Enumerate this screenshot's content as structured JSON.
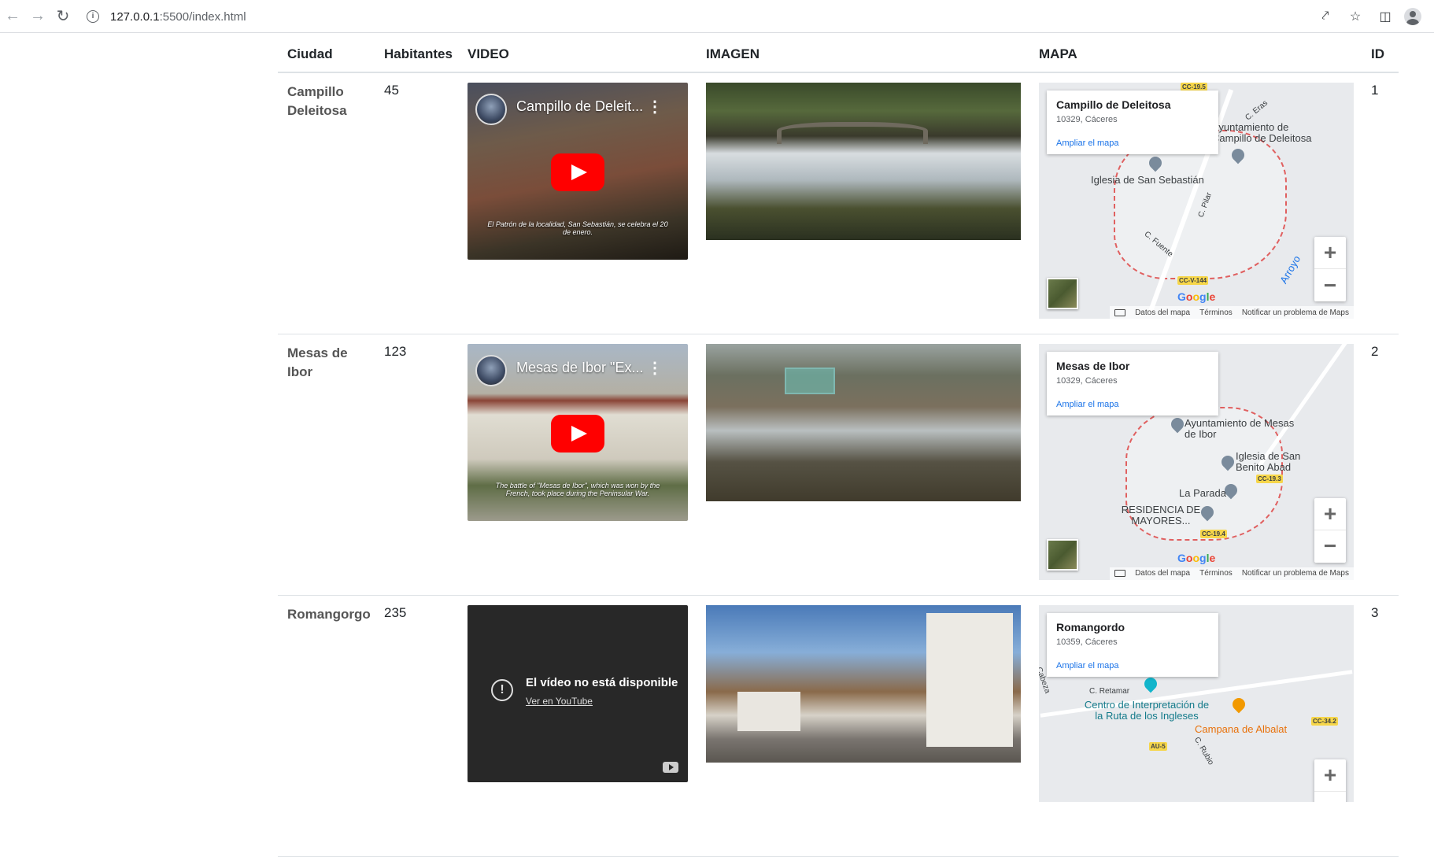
{
  "browser": {
    "url_host": "127.0.0.1",
    "url_rest": ":5500/index.html"
  },
  "table": {
    "headers": [
      "Ciudad",
      "Habitantes",
      "VIDEO",
      "IMAGEN",
      "MAPA",
      "ID"
    ],
    "rows": [
      {
        "ciudad": "Campillo Deleitosa",
        "habitantes": "45",
        "video_title": "Campillo de Deleit...",
        "video_caption": "El Patrón de la localidad, San Sebastián, se celebra el 20 de enero.",
        "map_title": "Campillo de Deleitosa",
        "map_sub": "10329, Cáceres",
        "map_link": "Ampliar el mapa",
        "map_labels": [
          "Iglesia de San Sebastián",
          "Ayuntamiento de Campillo de Deleitosa",
          "C. Pilar",
          "C. Fuente",
          "C. Eras",
          "Arroyo",
          "CC-19.5",
          "CC-V-144"
        ],
        "id": "1"
      },
      {
        "ciudad": "Mesas de Ibor",
        "habitantes": "123",
        "video_title": "Mesas de Ibor \"Ex...",
        "video_caption": "The battle of \"Mesas de Ibor\", which was won by the French, took place during the Peninsular War.",
        "map_title": "Mesas de Ibor",
        "map_sub": "10329, Cáceres",
        "map_link": "Ampliar el mapa",
        "map_labels": [
          "Ayuntamiento de Mesas de Ibor",
          "Iglesia de San Benito Abad",
          "La Parada",
          "RESIDENCIA DE MAYORES...",
          "CC-19.3",
          "CC-19.4"
        ],
        "id": "2"
      },
      {
        "ciudad": "Romangorgo",
        "habitantes": "235",
        "video_unavailable": "El vídeo no está disponible",
        "video_link": "Ver en YouTube",
        "map_title": "Romangordo",
        "map_sub": "10359, Cáceres",
        "map_link": "Ampliar el mapa",
        "map_labels": [
          "Centro de Interpretación de la Ruta de los Ingleses",
          "Campana de Albalat",
          "C. Retamar",
          "C. Rubio",
          "Cabeza",
          "CC-34.2",
          "AU-5"
        ],
        "id": "3"
      }
    ]
  },
  "map_footer": {
    "data": "Datos del mapa",
    "terms": "Términos",
    "report": "Notificar un problema de Maps"
  },
  "google": "Google"
}
